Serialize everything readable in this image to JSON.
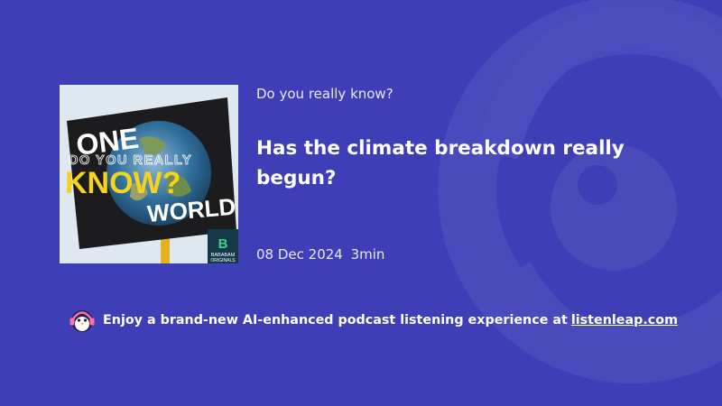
{
  "podcast": {
    "show_name": "Do you really know?",
    "cover_art": {
      "line_top": "ONE",
      "line_overlay": "DO YOU REALLY",
      "line_main": "KNOW?",
      "line_bottom": "WORLD",
      "badge_brand": "BABABAM",
      "badge_sub": "ORIGINALS"
    }
  },
  "episode": {
    "title": "Has the climate breakdown really begun?",
    "date": "08 Dec 2024",
    "duration": "3min"
  },
  "promo": {
    "text": "Enjoy a brand-new AI-enhanced podcast listening experience at",
    "link_text": "listenleap.com",
    "logo_icon": "penguin-headphones-icon"
  },
  "colors": {
    "background": "#3e3fb6",
    "text": "#ffffff",
    "accent_yellow": "#f5d21c"
  }
}
